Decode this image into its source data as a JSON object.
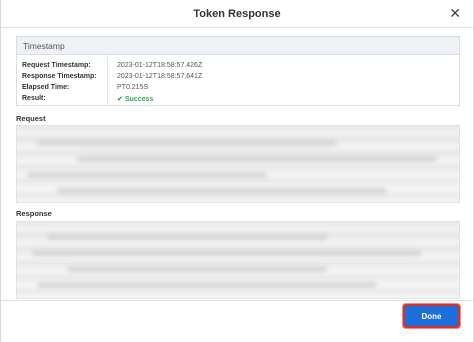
{
  "dialog": {
    "title": "Token Response",
    "close_glyph": "✕"
  },
  "timestamp_panel": {
    "header": "Timestamp",
    "rows": [
      {
        "label": "Request Timestamp:",
        "value": "2023-01-12T18:58:57.426Z"
      },
      {
        "label": "Response Timestamp:",
        "value": "2023-01-12T18:58:57.641Z"
      },
      {
        "label": "Elapsed Time:",
        "value": "PT0.215S"
      },
      {
        "label": "Result:",
        "value": "Success"
      }
    ],
    "success_color": "#2fa84f"
  },
  "request": {
    "label": "Request"
  },
  "response": {
    "label": "Response"
  },
  "footer": {
    "done_label": "Done",
    "done_color": "#1e6fd9",
    "highlight_color": "#d9322c"
  }
}
